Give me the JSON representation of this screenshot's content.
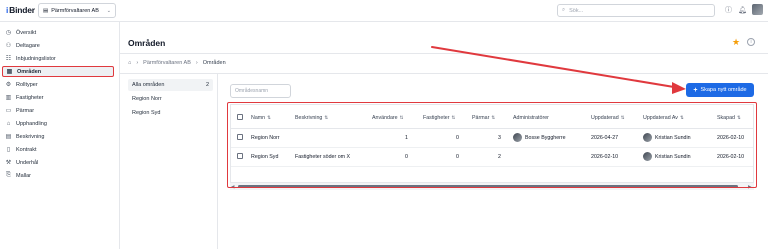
{
  "topbar": {
    "logo_text": "Binder",
    "logo_mark": "i",
    "org_name": "Pärmförvaltaren AB",
    "search_placeholder": "Sök...",
    "icons": [
      "help-icon",
      "bell-icon",
      "avatar"
    ]
  },
  "sidebar": {
    "items": [
      {
        "label": "Översikt",
        "icon": "clock-icon"
      },
      {
        "label": "Deltagare",
        "icon": "users-icon"
      },
      {
        "label": "Inbjudningslistor",
        "icon": "list-icon"
      },
      {
        "label": "Områden",
        "icon": "map-icon",
        "active": true
      },
      {
        "label": "Rolltyper",
        "icon": "roles-icon"
      },
      {
        "label": "Fastigheter",
        "icon": "building-icon"
      },
      {
        "label": "Pärmar",
        "icon": "binder-icon"
      },
      {
        "label": "Upphandling",
        "icon": "procurement-icon"
      },
      {
        "label": "Beskrivning",
        "icon": "description-icon"
      },
      {
        "label": "Kontrakt",
        "icon": "contract-icon"
      },
      {
        "label": "Underhål",
        "icon": "maintenance-icon"
      },
      {
        "label": "Mallar",
        "icon": "template-icon"
      }
    ]
  },
  "page": {
    "title": "Områden",
    "breadcrumb": [
      "Pärmförvaltaren AB",
      "Områden"
    ]
  },
  "filters": [
    {
      "label": "Alla områden",
      "count": "2",
      "selected": true
    },
    {
      "label": "Region Norr",
      "count": ""
    },
    {
      "label": "Region Syd",
      "count": ""
    }
  ],
  "toolbar": {
    "search_placeholder": "Områdesnamn",
    "create_label": "Skapa nytt område"
  },
  "table": {
    "headers": [
      "Namn",
      "Beskrivning",
      "Användare",
      "Fastigheter",
      "Pärmar",
      "Administratörer",
      "Uppdaterad",
      "Uppdaterad Av",
      "Skapad"
    ],
    "rows": [
      {
        "name": "Region Norr",
        "description": "",
        "users": "1",
        "properties": "0",
        "binders": "3",
        "admin": "Bosse Byggherre",
        "updated": "2026-04-27",
        "updated_by": "Kristian Sundin",
        "created": "2026-02-10"
      },
      {
        "name": "Region Syd",
        "description": "Fastigheter söder om X",
        "users": "0",
        "properties": "0",
        "binders": "2",
        "admin": "",
        "updated": "2026-02-10",
        "updated_by": "Kristian Sundin",
        "created": "2026-02-10"
      }
    ]
  },
  "colors": {
    "accent": "#1d6ae5",
    "annotation": "#e0393e",
    "star": "#f59e0b"
  }
}
